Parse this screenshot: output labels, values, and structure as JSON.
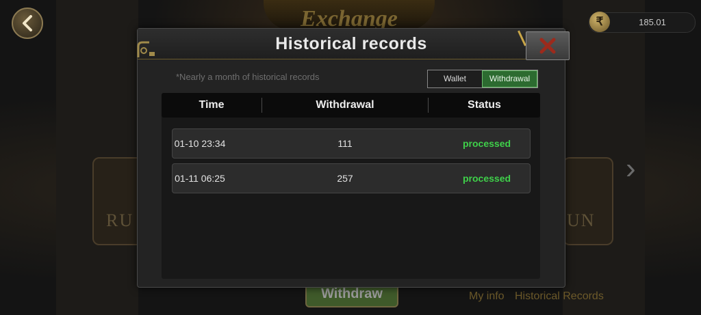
{
  "background": {
    "logo_text": "Exchange",
    "card_left_text": "RU",
    "card_right_text": "UN",
    "withdraw_button_label": "Withdraw",
    "link_my_info": "My info",
    "link_historical_records": "Historical Records"
  },
  "topbar": {
    "back_icon": "chevron-left-icon",
    "currency_symbol": "₹",
    "balance": "185.01"
  },
  "modal": {
    "title": "Historical records",
    "close_icon": "close-icon",
    "note": "*Nearly a month of historical records",
    "tabs": [
      {
        "label": "Wallet",
        "active": false
      },
      {
        "label": "Withdrawal",
        "active": true
      }
    ],
    "columns": [
      "Time",
      "Withdrawal",
      "Status"
    ],
    "rows": [
      {
        "time": "01-10 23:34",
        "amount": "111",
        "status": "processed"
      },
      {
        "time": "01-11 06:25",
        "amount": "257",
        "status": "processed"
      }
    ]
  },
  "colors": {
    "status_ok": "#3fd14a",
    "tab_active": "#2c6b30",
    "close_x": "#9c2a1c"
  }
}
